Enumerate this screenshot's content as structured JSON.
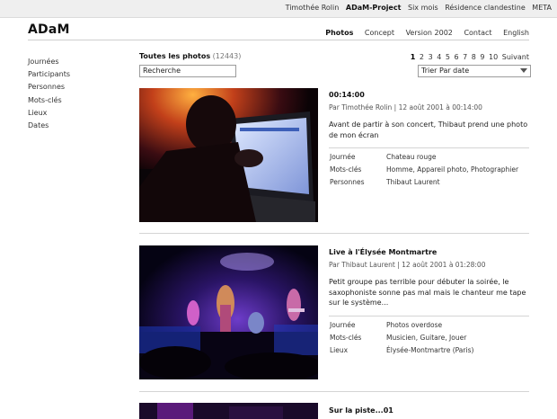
{
  "topbar": {
    "links": [
      "Timothée Rolin",
      "ADaM-Project",
      "Six mois",
      "Résidence clandestine",
      "META"
    ]
  },
  "logo": "ADaM",
  "nav": [
    "Photos",
    "Concept",
    "Version 2002",
    "Contact",
    "English"
  ],
  "sidebar": [
    "Journées",
    "Participants",
    "Personnes",
    "Mots-clés",
    "Lieux",
    "Dates"
  ],
  "section": {
    "title": "Toutes les photos",
    "count": "(12443)"
  },
  "pagination": [
    "1",
    "2",
    "3",
    "4",
    "5",
    "6",
    "7",
    "8",
    "9",
    "10",
    "Suivant"
  ],
  "search": {
    "value": "Recherche"
  },
  "sort": {
    "value": "Trier Par date"
  },
  "posts": [
    {
      "title": "00:14:00",
      "byline": "Par Timothée Rolin | 12 août 2001 à 00:14:00",
      "description": "Avant de partir à son concert, Thibaut prend une photo de mon écran",
      "meta": [
        {
          "key": "Journée",
          "value": "Chateau rouge"
        },
        {
          "key": "Mots-clés",
          "value": "Homme, Appareil photo, Photographier"
        },
        {
          "key": "Personnes",
          "value": "Thibaut Laurent"
        }
      ]
    },
    {
      "title": "Live à l'Élysée Montmartre",
      "byline": "Par Thibaut Laurent | 12 août 2001 à 01:28:00",
      "description": "Petit groupe pas terrible pour débuter la soirée, le saxophoniste sonne pas mal mais le chanteur me tape sur le système...",
      "meta": [
        {
          "key": "Journée",
          "value": "Photos overdose"
        },
        {
          "key": "Mots-clés",
          "value": "Musicien, Guitare, Jouer"
        },
        {
          "key": "Lieux",
          "value": "Élysée-Montmartre (Paris)"
        }
      ]
    },
    {
      "title": "Sur la piste...01"
    }
  ]
}
